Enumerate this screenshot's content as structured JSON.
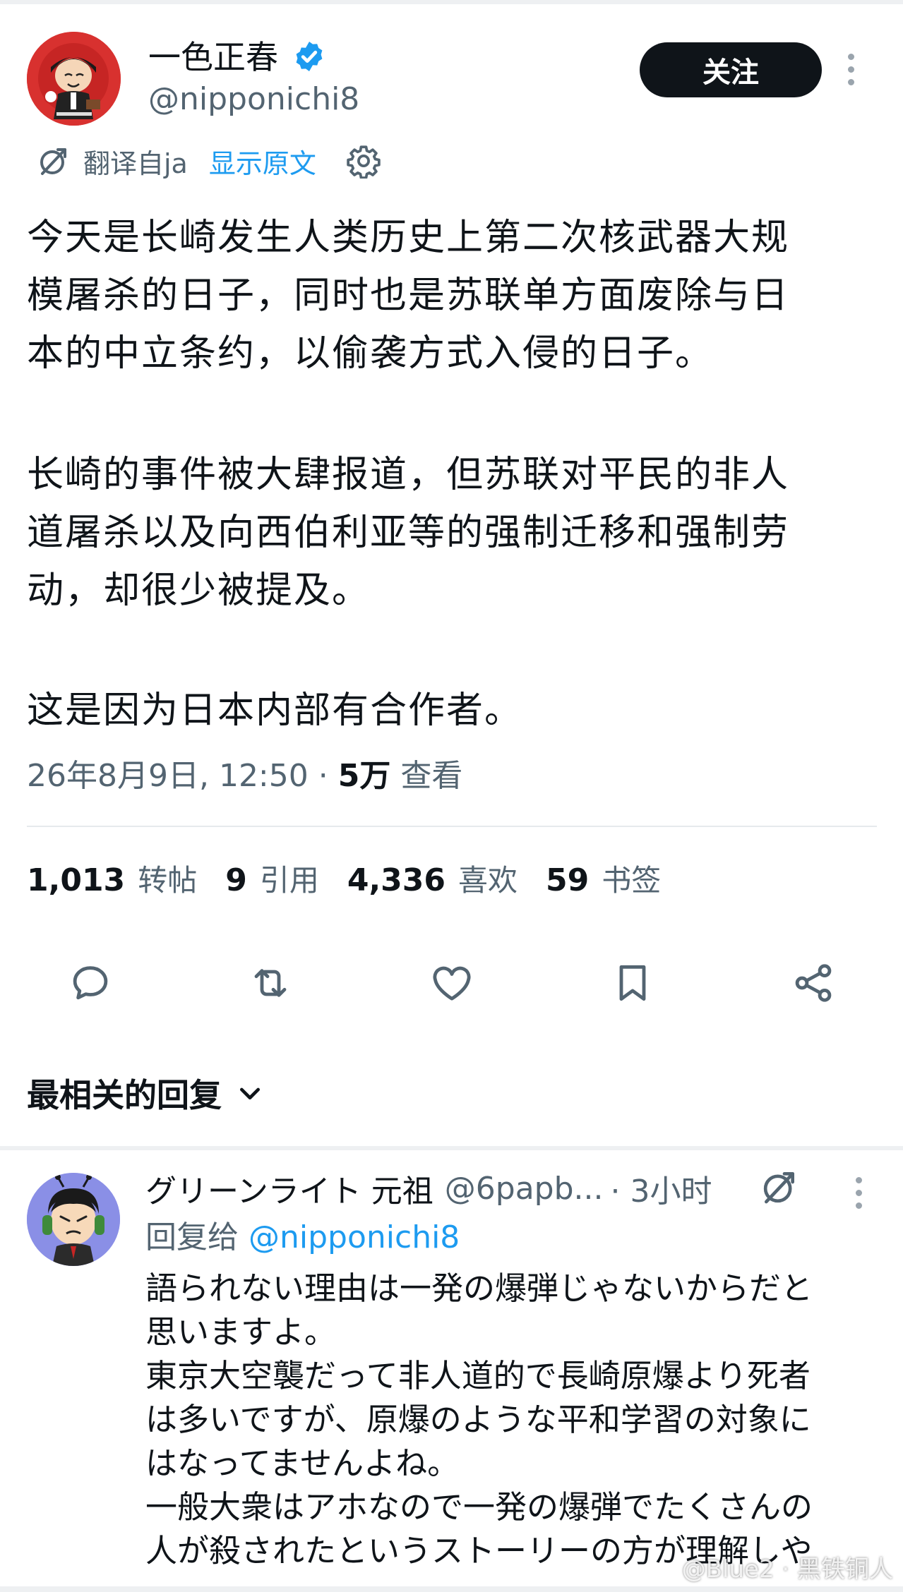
{
  "tweet": {
    "author_name": "一色正春",
    "author_handle": "@nipponichi8",
    "follow_label": "关注",
    "translate_from": "翻译自ja",
    "show_original": "显示原文",
    "paragraphs": [
      [
        "今天是长崎发生人类历史上第二次核武器大规",
        "模屠杀的日子，同时也是苏联单方面废除与日",
        "本的中立条约，以偷袭方式入侵的日子。"
      ],
      [
        "长崎的事件被大肆报道，但苏联对平民的非人",
        "道屠杀以及向西伯利亚等的强制迁移和强制劳",
        "动，却很少被提及。"
      ],
      [
        "这是因为日本内部有合作者。"
      ]
    ],
    "timestamp": "26年8月9日, 12:50 · ",
    "views_count": "5万",
    "views_label": " 查看",
    "stats": [
      {
        "num": "1,013",
        "label": "转帖"
      },
      {
        "num": "9",
        "label": "引用"
      },
      {
        "num": "4,336",
        "label": "喜欢"
      },
      {
        "num": "59",
        "label": "书签"
      }
    ]
  },
  "replies_sort_label": "最相关的回复",
  "reply": {
    "name": "グリーンライト 元祖",
    "handle": "@6papb...",
    "time": "· 3小时",
    "reply_to_prefix": "回复给 ",
    "reply_to_handle": "@nipponichi8",
    "lines": [
      "語られない理由は一発の爆弾じゃないからだと",
      "思いますよ。",
      "東京大空襲だって非人道的で長崎原爆より死者",
      "は多いですが、原爆のような平和学習の対象に",
      "はなってませんよね。",
      "一般大衆はアホなので一発の爆弾でたくさんの",
      "人が殺されたというストーリーの方が理解しや"
    ]
  },
  "watermark": "@Blue2 · 黑铁铜人",
  "colors": {
    "accent": "#1d9bf0",
    "text": "#0f1419",
    "muted": "#536471",
    "follow_button": "#0f1419",
    "verified": "#1d9bf0"
  },
  "icons": [
    "verified-badge-icon",
    "more-icon",
    "translate-icon",
    "settings-icon",
    "reply-icon",
    "retweet-icon",
    "like-icon",
    "bookmark-icon",
    "share-icon",
    "chevron-down-icon"
  ]
}
